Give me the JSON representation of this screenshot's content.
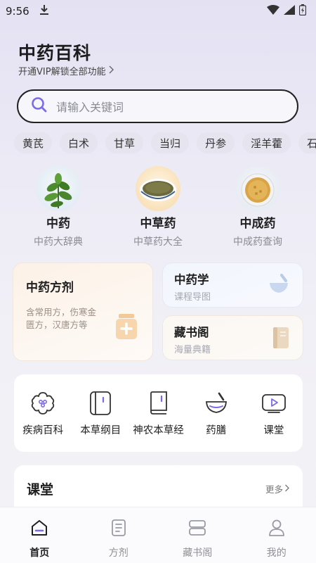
{
  "status_bar": {
    "time": "9:56"
  },
  "header": {
    "title": "中药百科",
    "vip_text": "开通VIP解锁全部功能"
  },
  "search": {
    "placeholder": "请输入关键词"
  },
  "herb_chips": [
    "黄芪",
    "白术",
    "甘草",
    "当归",
    "丹参",
    "淫羊藿",
    "石"
  ],
  "categories": [
    {
      "title": "中药",
      "subtitle": "中药大辞典"
    },
    {
      "title": "中草药",
      "subtitle": "中草药大全"
    },
    {
      "title": "中成药",
      "subtitle": "中成药查询"
    }
  ],
  "feature_cards": {
    "formula": {
      "title": "中药方剂",
      "desc": "含常用方，伤寒金匮方，汉唐方等"
    },
    "study": {
      "title": "中药学",
      "subtitle": "课程导图"
    },
    "library": {
      "title": "藏书阁",
      "subtitle": "海量典籍"
    }
  },
  "tools": [
    {
      "label": "疾病百科",
      "icon": "flower-icon"
    },
    {
      "label": "本草纲目",
      "icon": "book-tall-icon"
    },
    {
      "label": "神农本草经",
      "icon": "book-icon"
    },
    {
      "label": "药膳",
      "icon": "bowl-icon"
    },
    {
      "label": "课堂",
      "icon": "video-icon"
    }
  ],
  "course_section": {
    "title": "课堂",
    "more": "更多"
  },
  "tabbar": [
    {
      "label": "首页",
      "active": true
    },
    {
      "label": "方剂",
      "active": false
    },
    {
      "label": "藏书阁",
      "active": false
    },
    {
      "label": "我的",
      "active": false
    }
  ],
  "colors": {
    "accent": "#7b6be8",
    "background": "#ecebf5"
  }
}
